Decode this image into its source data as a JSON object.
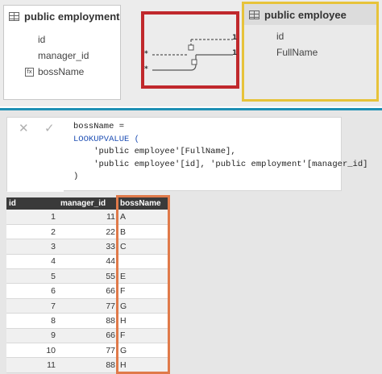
{
  "model": {
    "left_table": {
      "title": "public employment",
      "fields": [
        "id",
        "manager_id"
      ],
      "calc_field": "bossName"
    },
    "right_table": {
      "title": "public employee",
      "fields": [
        "id",
        "FullName"
      ]
    },
    "relationship": {
      "label_one_top": "1",
      "label_one_mid": "1",
      "label_many_mid": "*",
      "label_many_bottom": "*"
    },
    "colors": {
      "highlight_red": "#c0282c",
      "highlight_yellow": "#e7c33a",
      "highlight_orange": "#e07a4a",
      "divider": "#1e90b4"
    }
  },
  "formula": {
    "line1": "bossName =",
    "line2": "LOOKUPVALUE (",
    "line3": "    'public employee'[FullName],",
    "line4": "    'public employee'[id], 'public employment'[manager_id]",
    "line5": ")"
  },
  "grid": {
    "headers": [
      "id",
      "manager_id",
      "bossName"
    ],
    "rows": [
      [
        "1",
        "11",
        "A"
      ],
      [
        "2",
        "22",
        "B"
      ],
      [
        "3",
        "33",
        "C"
      ],
      [
        "4",
        "44",
        ""
      ],
      [
        "5",
        "55",
        "E"
      ],
      [
        "6",
        "66",
        "F"
      ],
      [
        "7",
        "77",
        "G"
      ],
      [
        "8",
        "88",
        "H"
      ],
      [
        "9",
        "66",
        "F"
      ],
      [
        "10",
        "77",
        "G"
      ],
      [
        "11",
        "88",
        "H"
      ]
    ]
  }
}
